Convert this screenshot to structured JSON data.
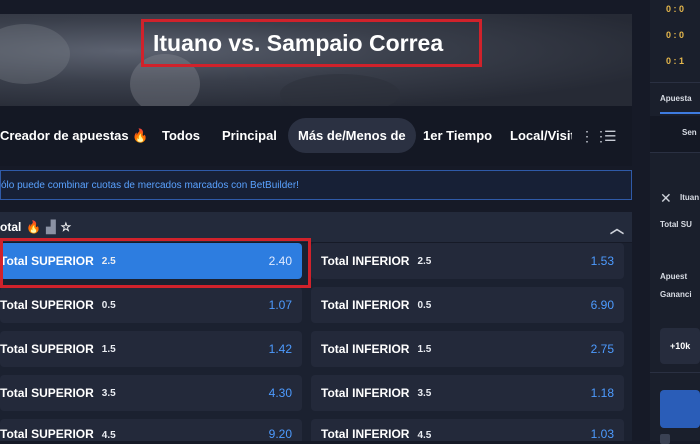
{
  "event": {
    "title": "Ituano vs. Sampaio Correa"
  },
  "tabs": [
    {
      "label": "Creador de apuestas 🔥"
    },
    {
      "label": "Todos"
    },
    {
      "label": "Principal"
    },
    {
      "label": "Más de/Menos de"
    },
    {
      "label": "1er Tiempo"
    },
    {
      "label": "Local/Visita"
    }
  ],
  "active_tab": "Más de/Menos de",
  "info_banner": "ólo puede combinar cuotas de mercados marcados con BetBuilder!",
  "market": {
    "name": "otal"
  },
  "odds": [
    {
      "left": {
        "label": "Total SUPERIOR",
        "line": "2.5",
        "price": "2.40",
        "selected": true
      },
      "right": {
        "label": "Total INFERIOR",
        "line": "2.5",
        "price": "1.53"
      }
    },
    {
      "left": {
        "label": "Total SUPERIOR",
        "line": "0.5",
        "price": "1.07"
      },
      "right": {
        "label": "Total INFERIOR",
        "line": "0.5",
        "price": "6.90"
      }
    },
    {
      "left": {
        "label": "Total SUPERIOR",
        "line": "1.5",
        "price": "1.42"
      },
      "right": {
        "label": "Total INFERIOR",
        "line": "1.5",
        "price": "2.75"
      }
    },
    {
      "left": {
        "label": "Total SUPERIOR",
        "line": "3.5",
        "price": "4.30"
      },
      "right": {
        "label": "Total INFERIOR",
        "line": "3.5",
        "price": "1.18"
      }
    },
    {
      "left": {
        "label": "Total SUPERIOR",
        "line": "4.5",
        "price": "9.20"
      },
      "right": {
        "label": "Total INFERIOR",
        "line": "4.5",
        "price": "1.03"
      }
    }
  ],
  "right_panel": {
    "scores": [
      "0 : 0",
      "0 : 0",
      "0 : 1"
    ],
    "tab_label": "Apuesta",
    "sub_tab": "Sen",
    "slip_event": "Ituan",
    "slip_selection": "Total SU",
    "stake_label": "Apuest",
    "gain_label": "Gananci",
    "quick_stake": "+10k"
  },
  "colors": {
    "accent": "#2d7de0",
    "price": "#4d9bff",
    "highlight": "#d0222b"
  }
}
